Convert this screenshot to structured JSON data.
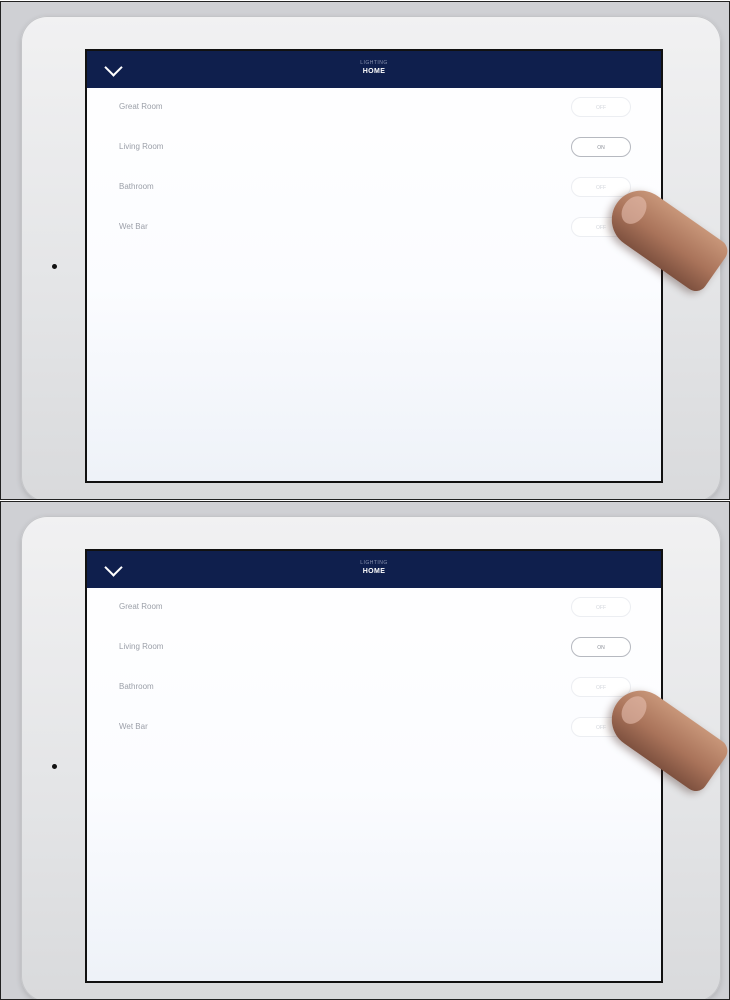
{
  "screenshots": [
    {
      "header": {
        "subtitle": "LIGHTING",
        "title": "HOME"
      },
      "rooms": [
        {
          "label": "Great Room",
          "toggle": "OFF",
          "on": false
        },
        {
          "label": "Living Room",
          "toggle": "ON",
          "on": true
        },
        {
          "label": "Bathroom",
          "toggle": "OFF",
          "on": false
        },
        {
          "label": "Wet Bar",
          "toggle": "OFF",
          "on": false
        }
      ]
    },
    {
      "header": {
        "subtitle": "LIGHTING",
        "title": "HOME"
      },
      "rooms": [
        {
          "label": "Great Room",
          "toggle": "OFF",
          "on": false
        },
        {
          "label": "Living Room",
          "toggle": "ON",
          "on": true
        },
        {
          "label": "Bathroom",
          "toggle": "OFF",
          "on": false
        },
        {
          "label": "Wet Bar",
          "toggle": "OFF",
          "on": false
        }
      ]
    }
  ],
  "colors": {
    "header_bg": "#0f1f4d",
    "toggle_on_border": "#b6b9c0",
    "room_text": "#9b9fa8"
  },
  "icons": {
    "back": "chevron-down-icon"
  }
}
